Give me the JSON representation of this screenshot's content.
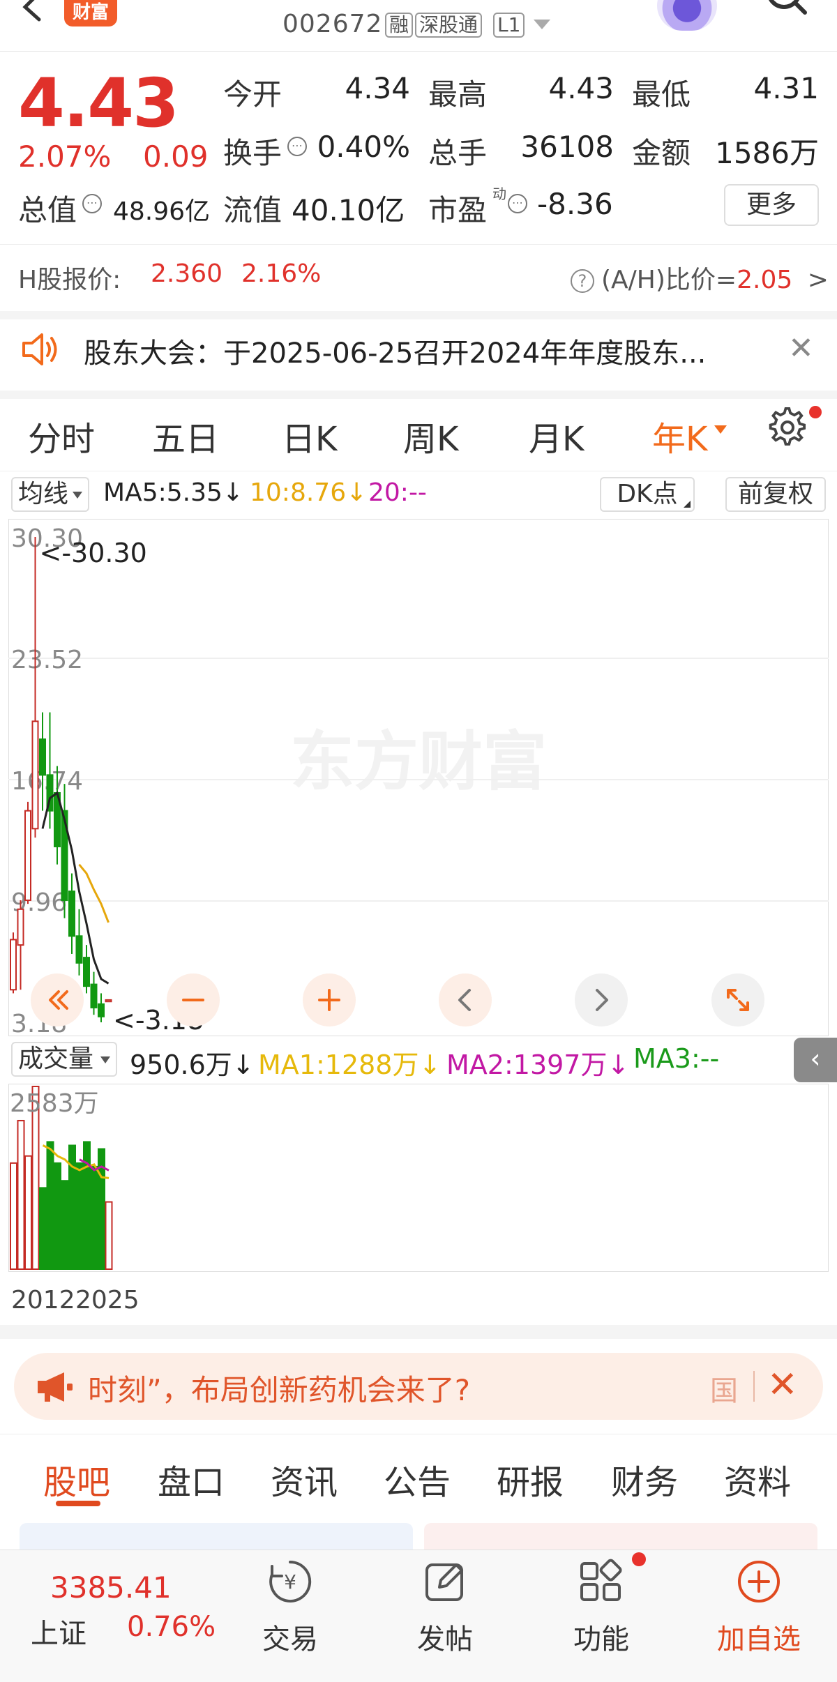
{
  "header": {
    "logo_text": "财富",
    "stock_code": "002672",
    "tags": [
      "融",
      "深股通",
      "L1"
    ]
  },
  "quote": {
    "price": "4.43",
    "change_pct": "2.07%",
    "change_abs": "0.09",
    "stats": [
      {
        "label": "今开",
        "value": "4.34",
        "color": "#222222"
      },
      {
        "label": "最高",
        "value": "4.43",
        "color": "#e0312b"
      },
      {
        "label": "最低",
        "value": "4.31",
        "color": "#1a9a1a"
      },
      {
        "label": "换手",
        "value": "0.40%",
        "color": "#222222"
      },
      {
        "label": "总手",
        "value": "36108",
        "color": "#222222"
      },
      {
        "label": "金额",
        "value": "1586万",
        "color": "#222222"
      },
      {
        "label": "流值",
        "value": "40.10亿",
        "color": "#222222"
      },
      {
        "label": "市盈",
        "value": "-8.36",
        "color": "#222222"
      }
    ],
    "mktcap_label": "总值",
    "mktcap_value": "48.96亿",
    "pe_superscript": "动",
    "more_label": "更多"
  },
  "h_share": {
    "label": "H股报价:",
    "price": "2.360",
    "pct": "2.16%",
    "ratio_label": "(A/H)比价=",
    "ratio_value": "2.05",
    "chevron": ">"
  },
  "notice": {
    "text": "股东大会：于2025-06-25召开2024年年度股东...",
    "close": "✕"
  },
  "chart_tabs": [
    "分时",
    "五日",
    "日K",
    "周K",
    "月K",
    "年K"
  ],
  "ma_legend": {
    "select_label": "均线",
    "ma5": "MA5:5.35↓",
    "ma10": "10:8.76↓",
    "ma20": "20:--",
    "dk_label": "DK点",
    "fq_label": "前复权"
  },
  "volume_legend": {
    "select_label": "成交量",
    "value": "950.6万↓",
    "ma1": "MA1:1288万↓",
    "ma2": "MA2:1397万↓",
    "ma3": "MA3:--"
  },
  "watermark": "东方财富",
  "chart_data": [
    {
      "type": "candlestick",
      "period": "yearly",
      "y_ticks": [
        "30.30",
        "23.52",
        "16.74",
        "9.96",
        "3.18"
      ],
      "ylim": [
        3.18,
        30.3
      ],
      "max_label": "<-30.30",
      "min_label": "<-3.18",
      "candles": [
        {
          "open": 5.0,
          "close": 7.8,
          "high": 8.2,
          "low": 4.8
        },
        {
          "open": 7.5,
          "close": 9.5,
          "high": 10.0,
          "low": 5.0
        },
        {
          "open": 10.0,
          "close": 15.0,
          "high": 15.5,
          "low": 9.8
        },
        {
          "open": 14.0,
          "close": 20.0,
          "high": 30.3,
          "low": 13.5
        },
        {
          "open": 19.0,
          "close": 17.0,
          "high": 20.5,
          "low": 15.0
        },
        {
          "open": 17.0,
          "close": 15.0,
          "high": 20.5,
          "low": 14.0
        },
        {
          "open": 16.0,
          "close": 13.0,
          "high": 17.5,
          "low": 12.0
        },
        {
          "open": 15.0,
          "close": 10.0,
          "high": 16.5,
          "low": 9.0
        },
        {
          "open": 10.5,
          "close": 8.0,
          "high": 11.5,
          "low": 7.0
        },
        {
          "open": 8.0,
          "close": 6.5,
          "high": 9.5,
          "low": 5.8
        },
        {
          "open": 6.8,
          "close": 5.2,
          "high": 7.5,
          "low": 4.8
        },
        {
          "open": 5.3,
          "close": 4.0,
          "high": 6.0,
          "low": 3.6
        },
        {
          "open": 4.2,
          "close": 3.5,
          "high": 4.8,
          "low": 3.18
        },
        {
          "open": 4.34,
          "close": 4.43,
          "high": 4.43,
          "low": 4.31
        }
      ],
      "ma5": [
        null,
        null,
        null,
        null,
        14.0,
        15.7,
        16.0,
        14.5,
        12.8,
        10.5,
        8.7,
        6.7,
        5.6,
        5.35
      ],
      "ma10": [
        null,
        null,
        null,
        null,
        null,
        null,
        null,
        null,
        null,
        12.0,
        11.5,
        10.6,
        9.8,
        8.76
      ]
    },
    {
      "type": "bar",
      "series_name": "成交量",
      "ylim": [
        0,
        2583
      ],
      "y_ticks": [
        "2583万"
      ],
      "values": [
        1500,
        2100,
        1600,
        2583,
        1150,
        1800,
        1500,
        1250,
        1750,
        1500,
        1800,
        1450,
        1700,
        950.6
      ],
      "ma1": [
        null,
        null,
        null,
        null,
        1750,
        1700,
        1600,
        1550,
        1450,
        1400,
        1450,
        1480,
        1300,
        1288
      ],
      "ma2": [
        null,
        null,
        null,
        null,
        null,
        null,
        null,
        null,
        null,
        1550,
        1500,
        1400,
        1450,
        1397
      ],
      "x_labels": [
        "2012",
        "2025"
      ]
    }
  ],
  "chart_controls": [
    "double-left-icon",
    "minus-icon",
    "plus-icon",
    "left-icon",
    "right-icon",
    "expand-icon"
  ],
  "ad": {
    "text": "时刻”，布局创新药机会来了?",
    "tag": "国"
  },
  "sub_tabs": [
    "股吧",
    "盘口",
    "资讯",
    "公告",
    "研报",
    "财务",
    "资料"
  ],
  "bottom_nav": {
    "index_value": "3385.41",
    "index_name": "上证",
    "index_pct": "0.76%",
    "items": [
      "交易",
      "发帖",
      "功能",
      "加自选"
    ]
  },
  "colors": {
    "up": "#e0312b",
    "down": "#1a9a1a",
    "accent": "#f26a1b",
    "ma5": "#222222",
    "ma10": "#e6a70b",
    "ma20": "#c218a4"
  }
}
